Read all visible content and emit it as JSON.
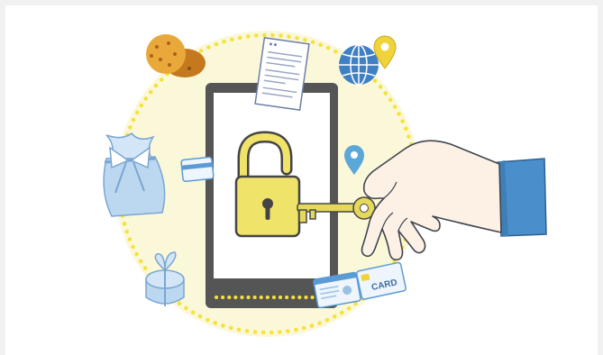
{
  "illustration": {
    "card": {
      "label": "CARD"
    },
    "colors": {
      "background": "#f1f1f1",
      "panel": "#ffffff",
      "glow": "#fbf8d9",
      "dots": "#f5e23b",
      "phone_frame": "#555555",
      "lock": "#f0e36a",
      "key": "#e6d85a",
      "hand_skin": "#fdf1e6",
      "sleeve": "#4a8ecb",
      "blue_accent": "#5b9bd5",
      "light_blue": "#bcd7f0",
      "cookie": "#e8a93a"
    },
    "icons": [
      "cookie-icon",
      "document-icon",
      "globe-icon",
      "map-pin-icon",
      "gift-bag-icon",
      "credit-card-icon",
      "gift-box-icon",
      "id-card-icon",
      "padlock-icon",
      "key-icon",
      "hand-icon"
    ]
  }
}
